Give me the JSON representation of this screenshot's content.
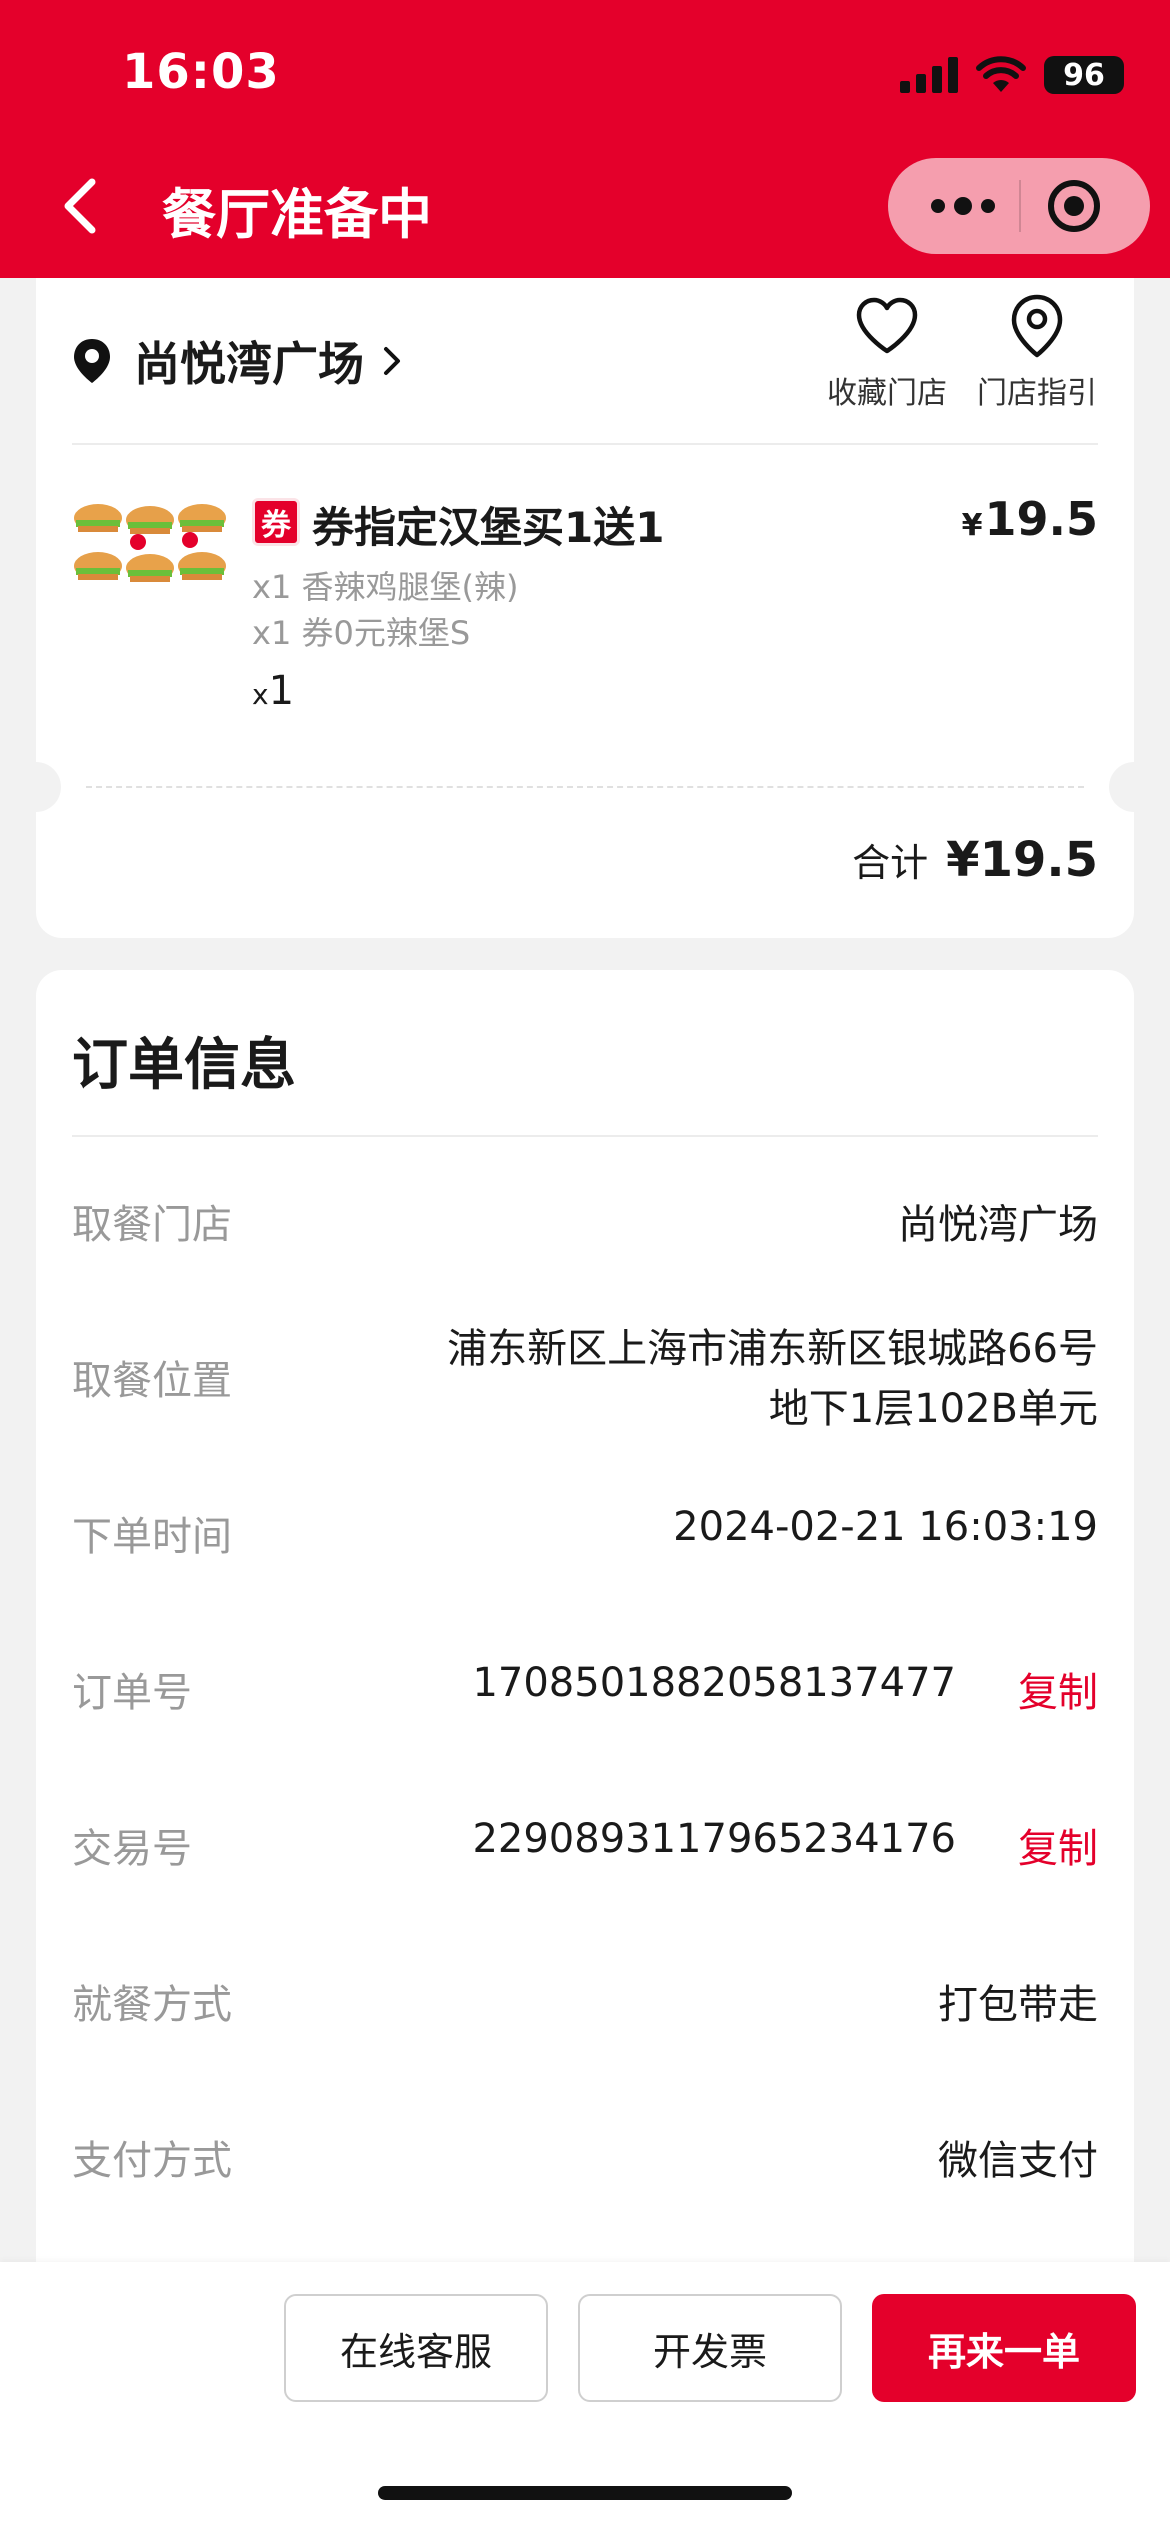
{
  "status_bar": {
    "time": "16:03",
    "battery": "96"
  },
  "nav": {
    "title": "餐厅准备中"
  },
  "store": {
    "name": "尚悦湾广场",
    "actions": [
      {
        "label": "收藏门店",
        "icon": "heart-icon"
      },
      {
        "label": "门店指引",
        "icon": "location-pin-icon"
      }
    ]
  },
  "order_item": {
    "badge": "券",
    "title": "券指定汉堡买1送1",
    "currency": "¥",
    "price": "19.5",
    "details": [
      "x1 香辣鸡腿堡(辣)",
      "x1 券0元辣堡S"
    ],
    "qty_prefix": "x",
    "qty": "1"
  },
  "summary": {
    "total_label": "合计",
    "total_value": "¥19.5"
  },
  "order_info": {
    "title": "订单信息",
    "pickup_store": {
      "label": "取餐门店",
      "value": "尚悦湾广场"
    },
    "pickup_location": {
      "label": "取餐位置",
      "value_line1": "浦东新区上海市浦东新区银城路66号",
      "value_line2": "地下1层102B单元"
    },
    "order_time": {
      "label": "下单时间",
      "value": "2024-02-21 16:03:19"
    },
    "order_no": {
      "label": "订单号",
      "value": "1708501882058137477",
      "action": "复制"
    },
    "transaction_no": {
      "label": "交易号",
      "value": "2290893117965234176",
      "action": "复制"
    },
    "dining_method": {
      "label": "就餐方式",
      "value": "打包带走"
    },
    "payment_method": {
      "label": "支付方式",
      "value": "微信支付"
    }
  },
  "bottom_actions": {
    "customer_service": "在线客服",
    "invoice": "开发票",
    "reorder": "再来一单"
  },
  "colors": {
    "brand_red": "#e4002b",
    "background": "#f2f2f2"
  }
}
